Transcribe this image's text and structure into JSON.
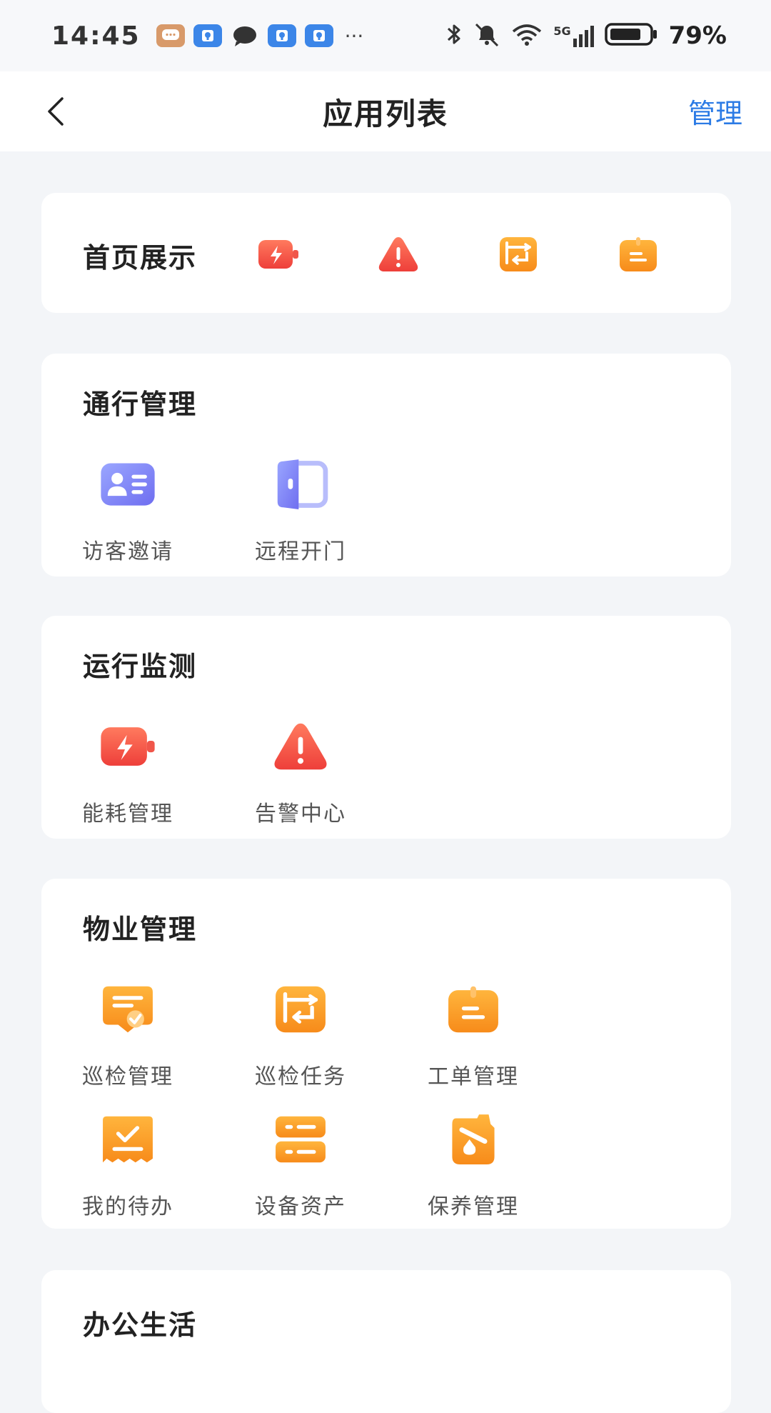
{
  "status_bar": {
    "time": "14:45",
    "battery": "79%",
    "network": "5G"
  },
  "nav": {
    "title": "应用列表",
    "manage_label": "管理"
  },
  "home_display": {
    "title": "首页展示",
    "icons": [
      "energy-icon",
      "alert-icon",
      "inspection-task-icon",
      "work-order-icon"
    ]
  },
  "sections": [
    {
      "title": "通行管理",
      "items": [
        {
          "label": "访客邀请",
          "icon": "visitor-card-icon"
        },
        {
          "label": "远程开门",
          "icon": "door-icon"
        }
      ]
    },
    {
      "title": "运行监测",
      "items": [
        {
          "label": "能耗管理",
          "icon": "energy-icon"
        },
        {
          "label": "告警中心",
          "icon": "alert-icon"
        }
      ]
    },
    {
      "title": "物业管理",
      "items": [
        {
          "label": "巡检管理",
          "icon": "inspection-icon"
        },
        {
          "label": "巡检任务",
          "icon": "inspection-task-icon"
        },
        {
          "label": "工单管理",
          "icon": "work-order-icon"
        },
        {
          "label": "我的待办",
          "icon": "todo-icon"
        },
        {
          "label": "设备资产",
          "icon": "asset-icon"
        },
        {
          "label": "保养管理",
          "icon": "maintenance-icon"
        }
      ]
    },
    {
      "title": "办公生活",
      "items": []
    }
  ],
  "colors": {
    "accent": "#2c7be5",
    "orange": "#f7a024",
    "red": "#f0564a",
    "purple": "#7b83f2"
  }
}
